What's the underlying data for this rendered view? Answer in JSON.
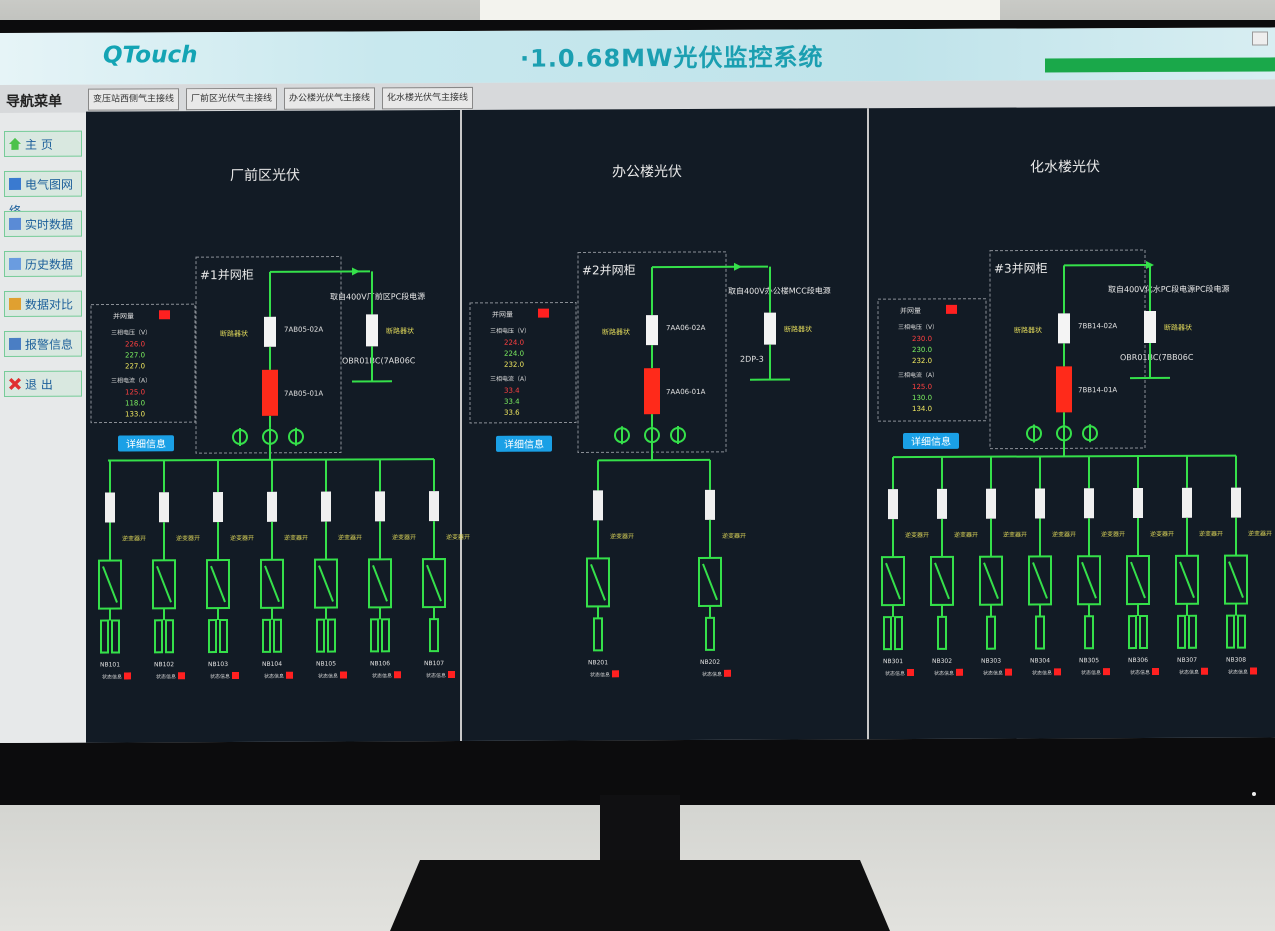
{
  "app": {
    "logo": "QTouch",
    "title": "·1.0.68MW光伏监控系统"
  },
  "tabs": [
    "变压站西侧气主接线",
    "厂前区光伏气主接线",
    "办公楼光伏气主接线",
    "化水楼光伏气主接线"
  ],
  "nav": {
    "title": "导航菜单",
    "items": [
      "主 页",
      "电气图网络",
      "实时数据",
      "历史数据",
      "数据对比",
      "报警信息",
      "退 出"
    ]
  },
  "panels": [
    {
      "title": "厂前区光伏",
      "cabinet": "#1并网柜",
      "feed": "取自400V厂前区PC段电源",
      "switch_label": "断路器状",
      "breaker_a": "7AB05-02A",
      "breaker_b": "7AB05-01A",
      "feed_code": "OBR01BC(7AB06C",
      "stats_label": "并网量",
      "voltage_label": "三相电压（V）",
      "voltages": [
        "226.0",
        "227.0",
        "227.0"
      ],
      "current_label": "三相电流（A）",
      "currents": [
        "125.0",
        "118.0",
        "133.0"
      ],
      "details": "详细信息",
      "branch_label": "逆变器开",
      "inverters": [
        "NB101",
        "NB102",
        "NB103",
        "NB104",
        "NB105",
        "NB106",
        "NB107"
      ],
      "inv_status": "状态信息"
    },
    {
      "title": "办公楼光伏",
      "cabinet": "#2并网柜",
      "feed": "取自400V办公楼MCC段电源",
      "switch_label": "断路器状",
      "breaker_a": "7AA06-02A",
      "breaker_b": "7AA06-01A",
      "feed_code": "2DP-3",
      "stats_label": "并网量",
      "voltage_label": "三相电压（V）",
      "voltages": [
        "224.0",
        "224.0",
        "232.0"
      ],
      "current_label": "三相电流（A）",
      "currents": [
        "33.4",
        "33.4",
        "33.6"
      ],
      "details": "详细信息",
      "branch_label": "逆变器开",
      "inverters": [
        "NB201",
        "NB202"
      ],
      "inv_status": "状态信息"
    },
    {
      "title": "化水楼光伏",
      "cabinet": "#3并网柜",
      "feed": "取自400V化水PC段电源PC段电源",
      "switch_label": "断路器状",
      "breaker_a": "7BB14-02A",
      "breaker_b": "7BB14-01A",
      "feed_code": "OBR01BC(7BB06C",
      "stats_label": "并网量",
      "voltage_label": "三相电压（V）",
      "voltages": [
        "230.0",
        "230.0",
        "232.0"
      ],
      "current_label": "三相电流（A）",
      "currents": [
        "125.0",
        "130.0",
        "134.0"
      ],
      "details": "详细信息",
      "branch_label": "逆变器开",
      "inverters": [
        "NB301",
        "NB302",
        "NB303",
        "NB304",
        "NB305",
        "NB306",
        "NB307",
        "NB308"
      ],
      "inv_status": "状态信息"
    }
  ],
  "colors": {
    "line": "#35e04a",
    "breaker_closed": "#ff2a1a",
    "status": "#ff2020",
    "button": "#1aa0e6"
  }
}
